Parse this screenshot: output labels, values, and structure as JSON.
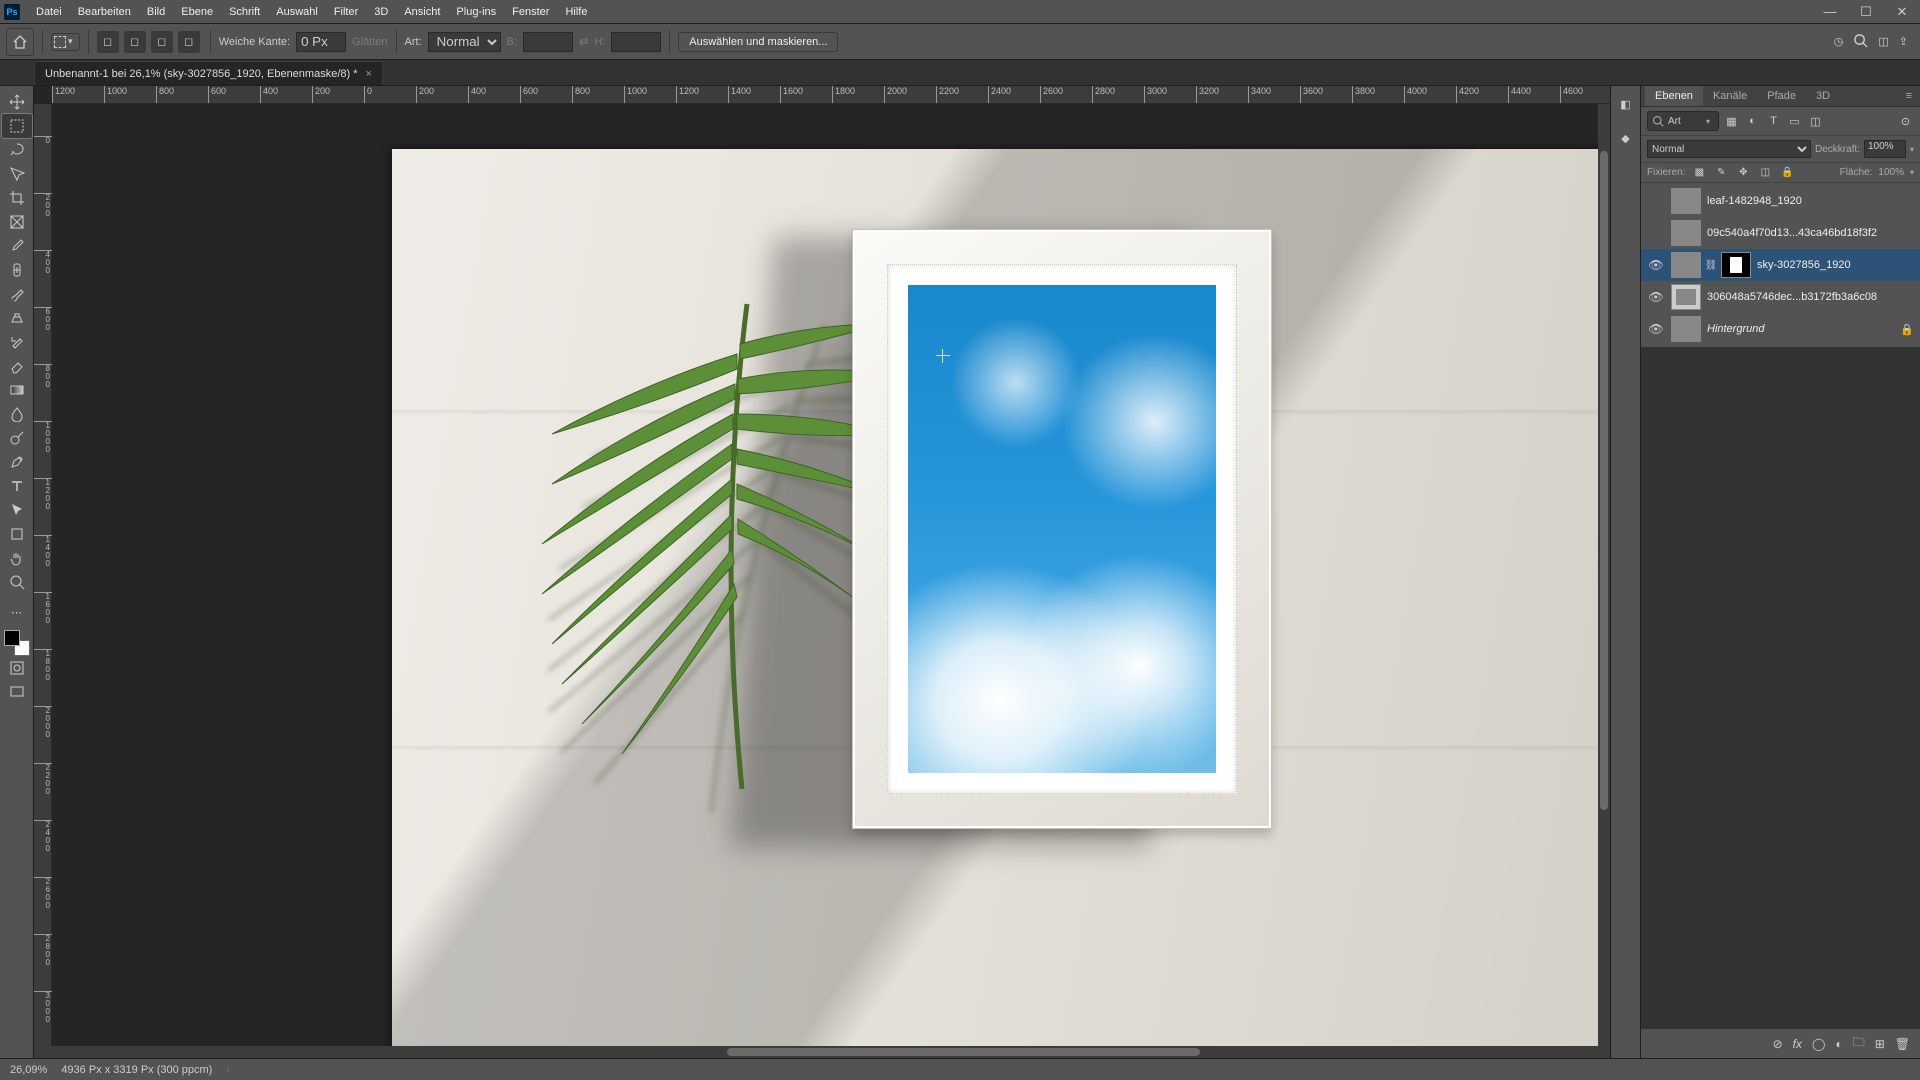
{
  "menu": {
    "items": [
      "Datei",
      "Bearbeiten",
      "Bild",
      "Ebene",
      "Schrift",
      "Auswahl",
      "Filter",
      "3D",
      "Ansicht",
      "Plug-ins",
      "Fenster",
      "Hilfe"
    ]
  },
  "options": {
    "feather_label": "Weiche Kante:",
    "feather_value": "0 Px",
    "antialias_label": "Glätten",
    "style_label": "Art:",
    "style_value": "Normal",
    "width_label": "B:",
    "height_label": "H:",
    "mask_button": "Auswählen und maskieren..."
  },
  "document": {
    "tab_title": "Unbenannt-1 bei 26,1% (sky-3027856_1920, Ebenenmaske/8) *"
  },
  "ruler": {
    "h": [
      "1200",
      "1000",
      "800",
      "600",
      "400",
      "200",
      "0",
      "200",
      "400",
      "600",
      "800",
      "1000",
      "1200",
      "1400",
      "1600",
      "1800",
      "2000",
      "2200",
      "2400",
      "2600",
      "2800",
      "3000",
      "3200",
      "3400",
      "3600",
      "3800",
      "4000",
      "4200",
      "4400",
      "4600"
    ],
    "v": [
      "0",
      "200",
      "400",
      "600",
      "800",
      "1000",
      "1200",
      "1400",
      "1600",
      "1800",
      "2000",
      "2200",
      "2400",
      "2600",
      "2800",
      "3000"
    ]
  },
  "panels": {
    "tabs": {
      "ebenen": "Ebenen",
      "kanale": "Kanäle",
      "pfade": "Pfade",
      "d3": "3D"
    },
    "search_placeholder": "Art",
    "blend_mode": "Normal",
    "opacity_label": "Deckkraft:",
    "opacity_value": "100%",
    "lock_label": "Fixieren:",
    "fill_label": "Fläche:",
    "fill_value": "100%",
    "layers": [
      {
        "name": "leaf-1482948_1920",
        "visible": false,
        "mask": false,
        "thumb": "th-leaf",
        "lock": false
      },
      {
        "name": "09c540a4f70d13...43ca46bd18f3f2",
        "visible": false,
        "mask": false,
        "thumb": "th-hash",
        "lock": false
      },
      {
        "name": "sky-3027856_1920",
        "visible": true,
        "mask": true,
        "thumb": "th-sky",
        "selected": true,
        "lock": false
      },
      {
        "name": "306048a5746dec...b3172fb3a6c08",
        "visible": true,
        "mask": false,
        "thumb": "th-frame",
        "lock": false
      },
      {
        "name": "Hintergrund",
        "visible": true,
        "mask": false,
        "thumb": "th-white",
        "italic": true,
        "lock": true
      }
    ]
  },
  "status": {
    "zoom": "26,09%",
    "info": "4936 Px x 3319 Px (300 ppcm)"
  }
}
